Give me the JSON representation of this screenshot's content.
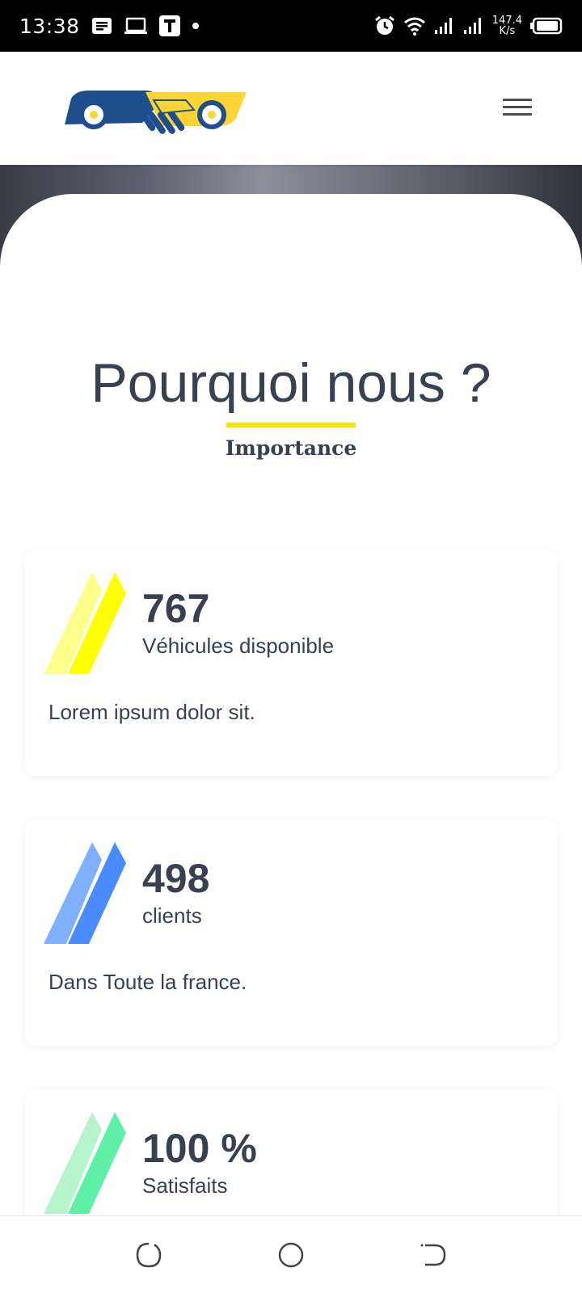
{
  "status_bar": {
    "time": "13:38",
    "net_speed_value": "147.4",
    "net_speed_unit": "K/s",
    "left_icons": [
      "message-icon",
      "laptop-icon",
      "t-app-icon",
      "dot-icon"
    ],
    "right_icons": [
      "alarm-icon",
      "wifi-icon",
      "signal-icon",
      "signal-icon",
      "battery-icon"
    ]
  },
  "header": {
    "logo": "handshake-car-logo",
    "menu_icon": "hamburger-menu-icon"
  },
  "section": {
    "title": "Pourquoi nous ?",
    "subtitle": "Importance",
    "accent_color": "#f7e400"
  },
  "stats": [
    {
      "value": "767",
      "label": "Véhicules disponible",
      "description": "Lorem ipsum dolor sit.",
      "color_light": "#fcff8a",
      "color_dark": "#ffff00"
    },
    {
      "value": "498",
      "label": "clients",
      "description": "Dans Toute la france.",
      "color_light": "#7fb0ff",
      "color_dark": "#4a8cff"
    },
    {
      "value": "100 %",
      "label": "Satisfaits",
      "description": "",
      "color_light": "#b6f4cc",
      "color_dark": "#5ff0a8"
    }
  ],
  "nav_bar": {
    "icons": [
      "recent-apps-icon",
      "home-icon",
      "back-icon"
    ]
  }
}
